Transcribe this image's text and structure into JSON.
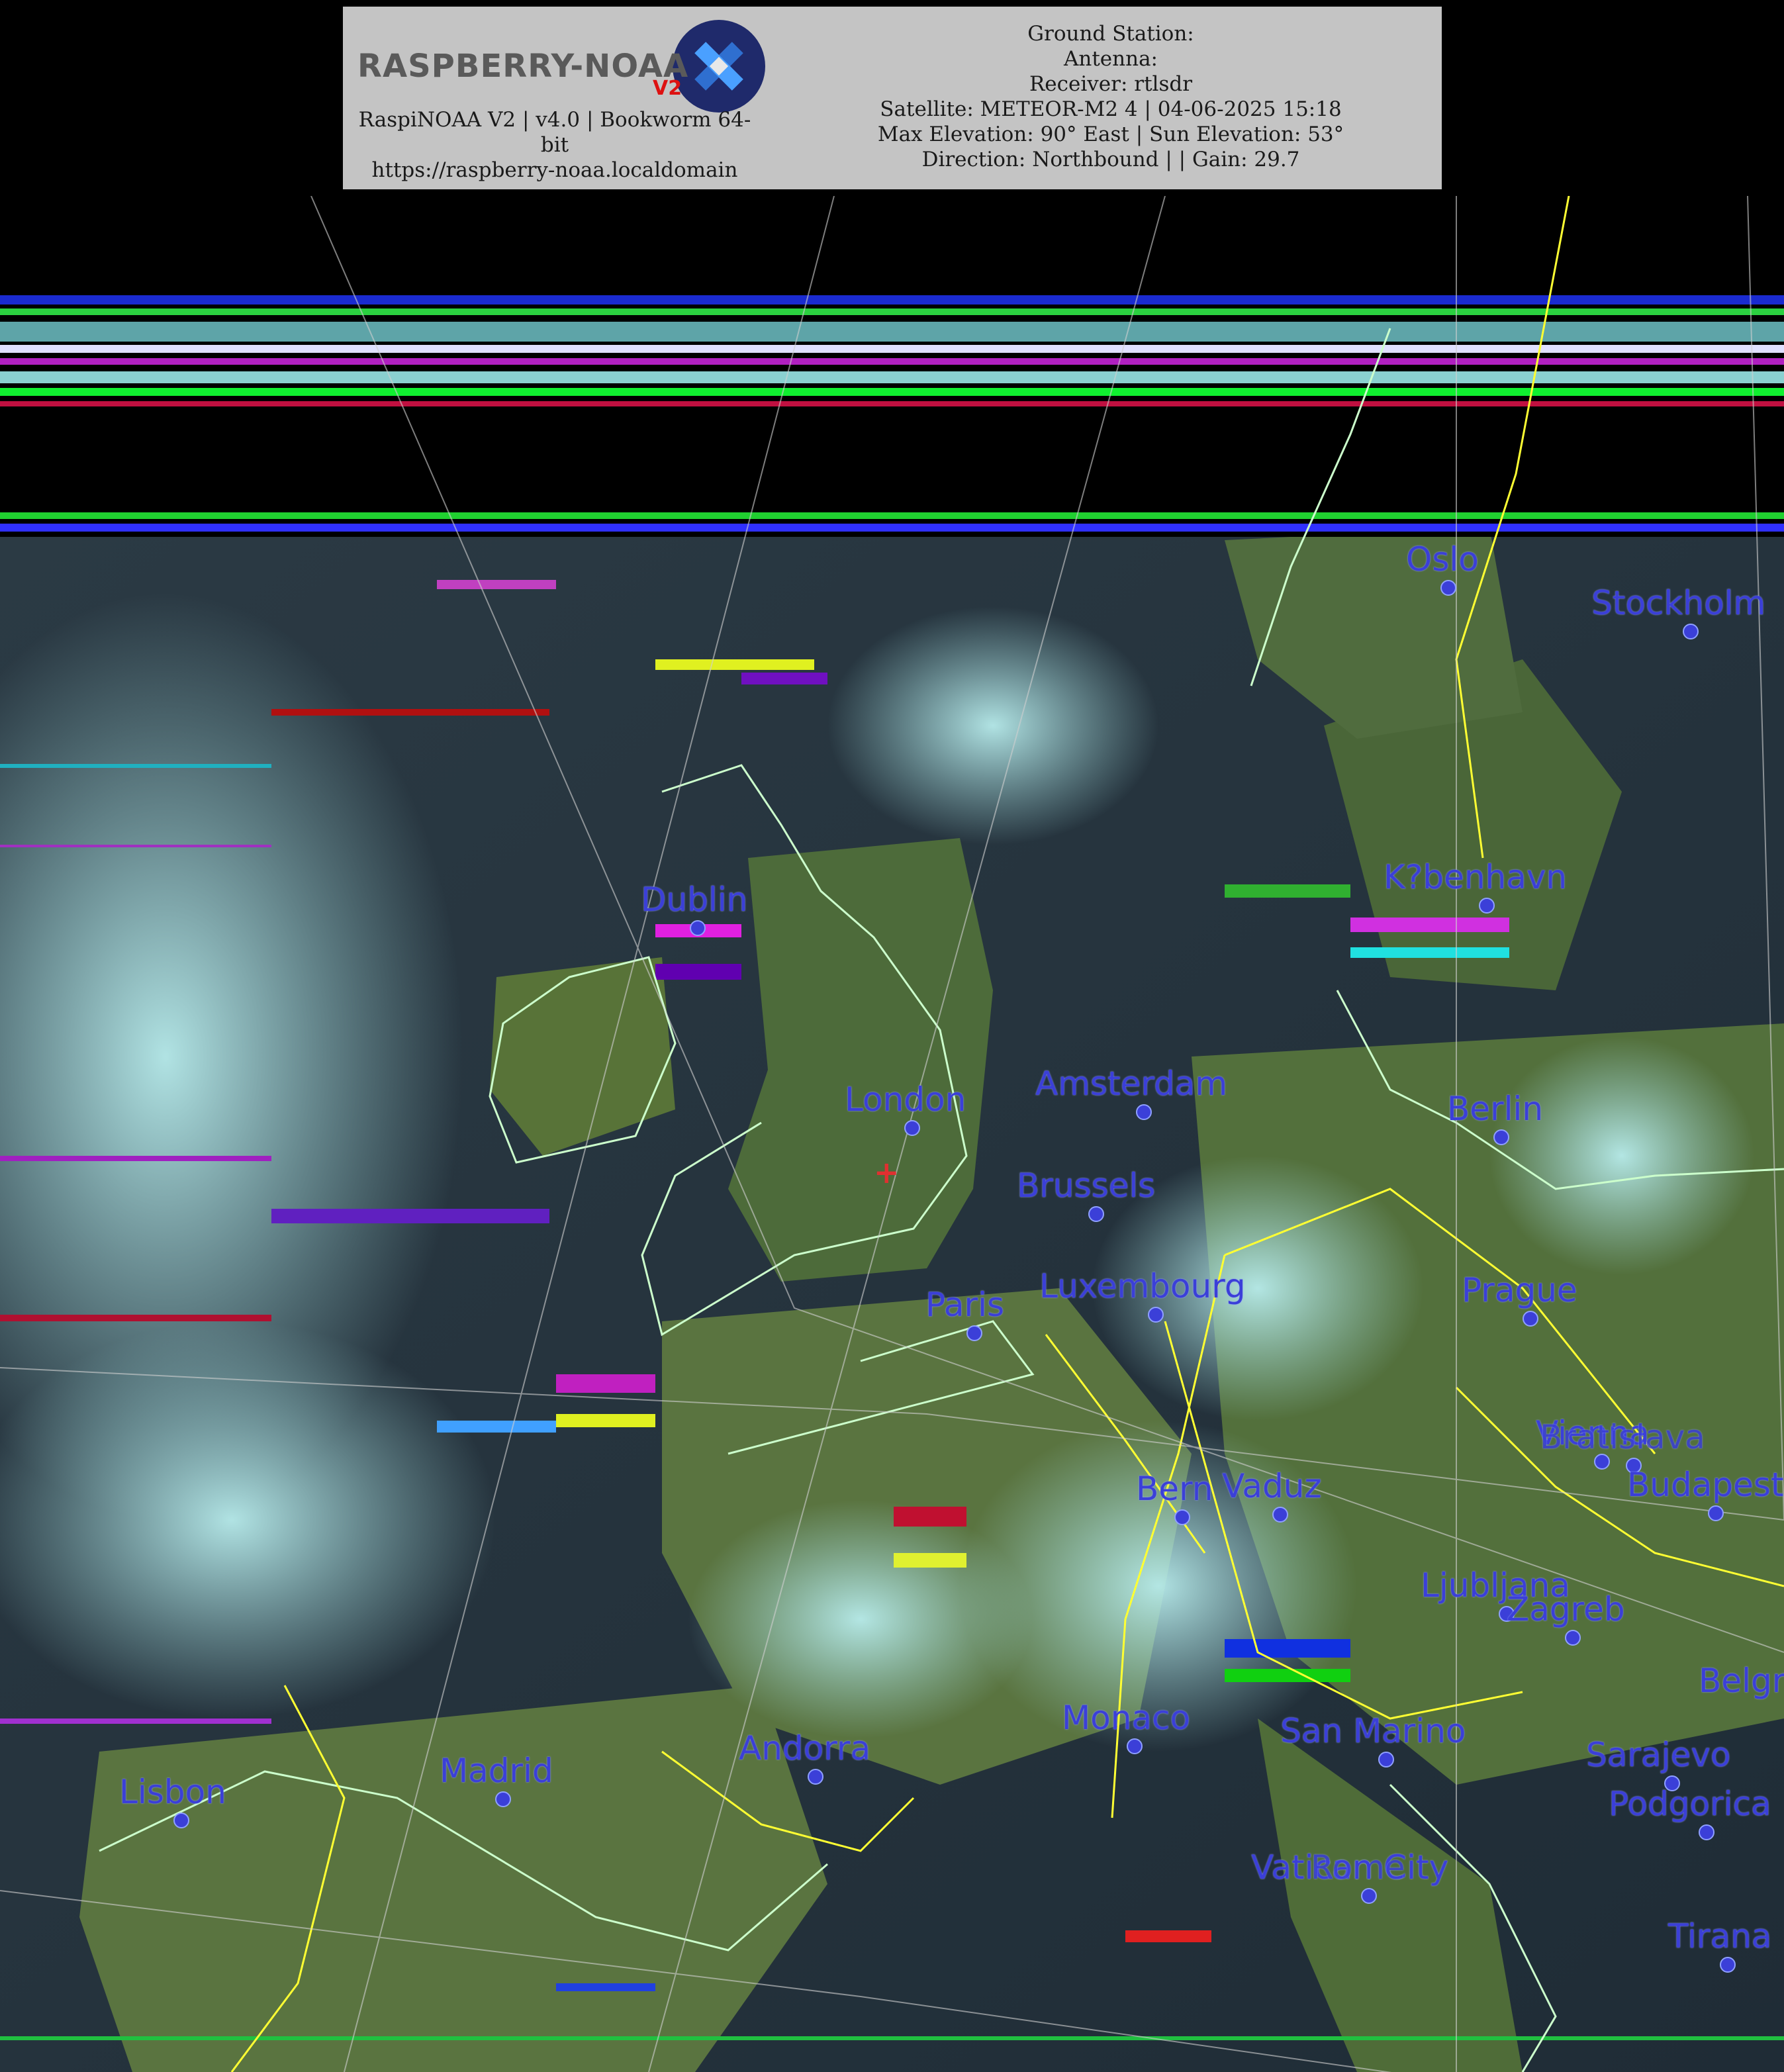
{
  "header": {
    "logo_text": "RASPBERRY-NOAA",
    "logo_badge": "V2",
    "left_lines": [
      "RaspiNOAA V2 | v4.0 | Bookworm 64-",
      "bit",
      "https://raspberry-noaa.localdomain"
    ],
    "right_lines": [
      "Ground Station:",
      "Antenna:",
      "Receiver: rtlsdr",
      "Satellite: METEOR-M2 4 | 04-06-2025 15:18",
      "Max Elevation: 90° East | Sun Elevation: 53°",
      "Direction: Northbound | | Gain: 29.7"
    ]
  },
  "map": {
    "label_color": "#3b3fd8",
    "border_color": "#ffff33",
    "coast_color": "#ccffcc",
    "cities": [
      {
        "name": "Oslo"
      },
      {
        "name": "Stockholm"
      },
      {
        "name": "K?benhavn"
      },
      {
        "name": "Dublin"
      },
      {
        "name": "London"
      },
      {
        "name": "Amsterdam"
      },
      {
        "name": "Berlin"
      },
      {
        "name": "Brussels"
      },
      {
        "name": "Luxembourg"
      },
      {
        "name": "Paris"
      },
      {
        "name": "Prague"
      },
      {
        "name": "Vienna"
      },
      {
        "name": "Bratislava"
      },
      {
        "name": "Budapest"
      },
      {
        "name": "Bern"
      },
      {
        "name": "Vaduz"
      },
      {
        "name": "Ljubljana"
      },
      {
        "name": "Zagreb"
      },
      {
        "name": "Belgrade"
      },
      {
        "name": "Monaco"
      },
      {
        "name": "San Marino"
      },
      {
        "name": "Andorra"
      },
      {
        "name": "Sarajevo"
      },
      {
        "name": "Madrid"
      },
      {
        "name": "Lisbon"
      },
      {
        "name": "Podgorica"
      },
      {
        "name": "Vatican City"
      },
      {
        "name": "Rome"
      },
      {
        "name": "Tirana"
      }
    ],
    "station_marker": "+"
  }
}
